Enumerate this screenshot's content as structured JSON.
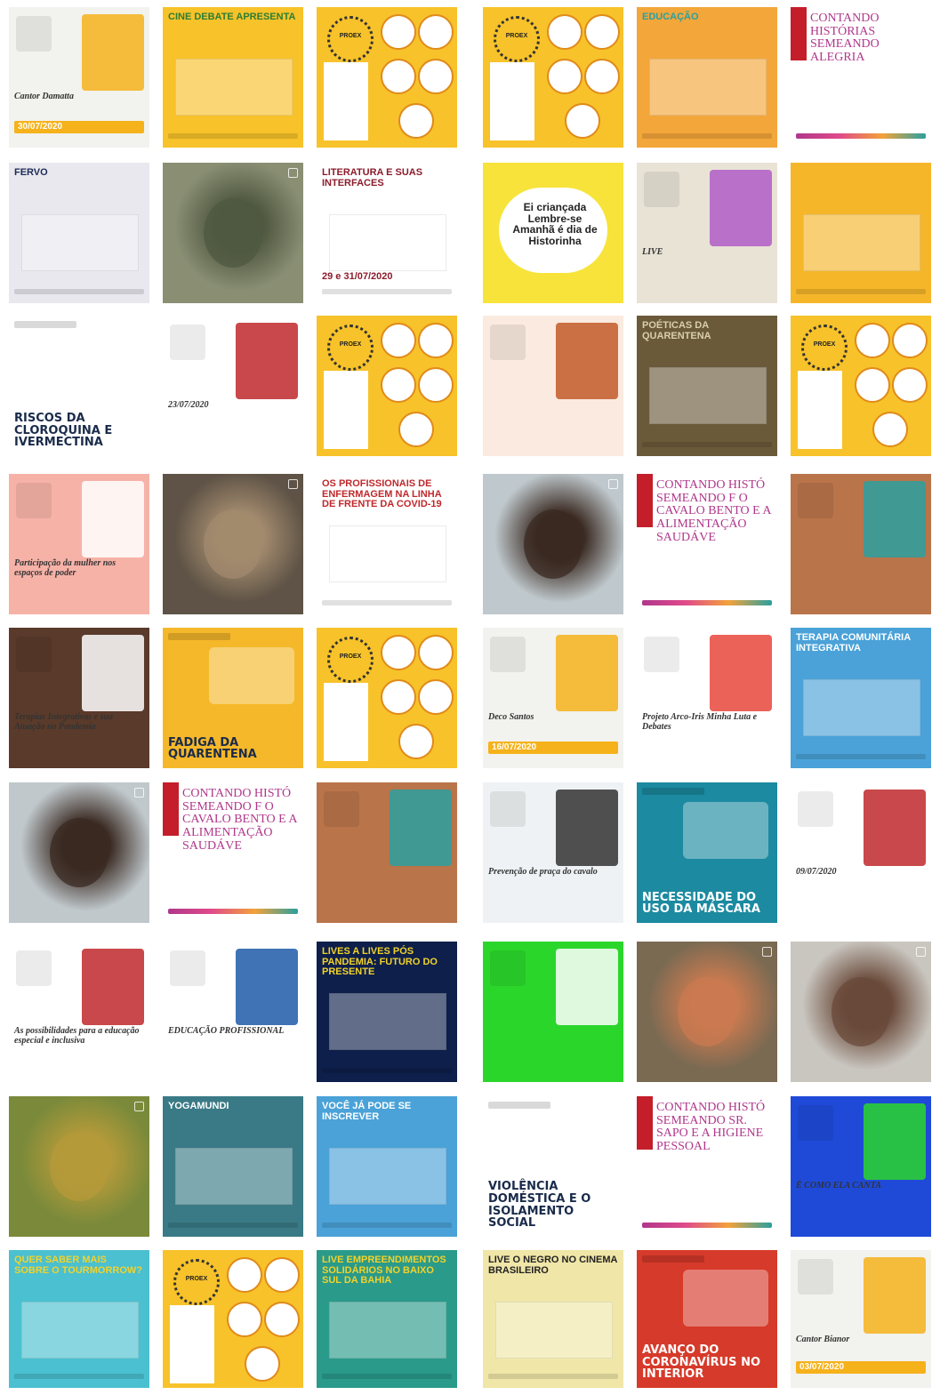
{
  "grid": {
    "tiles": [
      {
        "label": "Cantor Damatta",
        "date": "30/07/2020",
        "bg": "#f2f2ee",
        "accent": "#f6b21b",
        "style": "mixed"
      },
      {
        "label": "CINE DEBATE APRESENTA",
        "bg": "#f7c22a",
        "accent": "#2e7d32",
        "style": "banner"
      },
      {
        "label": "PROEX",
        "bg": "#f7c22a",
        "accent": "#ffffff",
        "style": "ring"
      },
      {
        "label": "PROEX",
        "bg": "#f7c22a",
        "accent": "#ffffff",
        "style": "ring"
      },
      {
        "label": "EDUCAÇÃO",
        "bg": "#f3a63a",
        "accent": "#2aa0a0",
        "style": "banner"
      },
      {
        "label": "CONTANDO HISTÓRIAS SEMEANDO ALEGRIA",
        "bg": "#ffffff",
        "accent": "#b0378b",
        "style": "contando"
      },
      {
        "label": "FERVO",
        "bg": "#e8e8ee",
        "accent": "#1d2a55",
        "style": "banner"
      },
      {
        "label": "",
        "bg": "#8a8f74",
        "accent": "#4f5840",
        "style": "photo"
      },
      {
        "label": "LITERATURA E SUAS INTERFACES",
        "date": "29 e 31/07/2020",
        "bg": "#ffffff",
        "accent": "#8b1c2c",
        "style": "banner"
      },
      {
        "label": "Ei criançada Lembre-se Amanhã é dia de Historinha",
        "bg": "#f7e33a",
        "accent": "#ffffff",
        "style": "cloud"
      },
      {
        "label": "LIVE",
        "bg": "#e9e3d6",
        "accent": "#b05cc7",
        "style": "mixed"
      },
      {
        "label": "",
        "bg": "#f5b62a",
        "accent": "#ffffff",
        "style": "banner"
      },
      {
        "label": "RISCOS DA CLOROQUINA E IVERMECTINA",
        "bg": "#ffffff",
        "accent": "#1a2b4a",
        "style": "boletim"
      },
      {
        "label": "23/07/2020",
        "bg": "#ffffff",
        "accent": "#c0282c",
        "style": "mixed"
      },
      {
        "label": "PROEX",
        "bg": "#f7c22a",
        "accent": "#ffffff",
        "style": "ring"
      },
      {
        "label": "",
        "bg": "#faeadf",
        "accent": "#c25a2a",
        "style": "mixed"
      },
      {
        "label": "POÉTICAS DA QUARENTENA",
        "bg": "#6b5a3a",
        "accent": "#d8cfae",
        "style": "banner"
      },
      {
        "label": "PROEX",
        "bg": "#f7c22a",
        "accent": "#ffffff",
        "style": "ring"
      },
      {
        "label": "Participação da mulher nos espaços de poder",
        "bg": "#f7b2a8",
        "accent": "#ffffff",
        "style": "mixed"
      },
      {
        "label": "",
        "bg": "#5e5346",
        "accent": "#a28a6e",
        "style": "photo"
      },
      {
        "label": "Os profissionais de enfermagem na linha de frente da Covid-19",
        "bg": "#ffffff",
        "accent": "#c0282c",
        "style": "banner"
      },
      {
        "label": "",
        "bg": "#bfc8cc",
        "accent": "#3a2a22",
        "style": "photo"
      },
      {
        "label": "CONTANDO HISTÓ SEMEANDO F O CAVALO BENTO E A ALIMENTAÇÃO SAUDÁVE",
        "bg": "#ffffff",
        "accent": "#b0378b",
        "style": "contando"
      },
      {
        "label": "",
        "bg": "#b9744a",
        "accent": "#2aa0a0",
        "style": "mixed"
      },
      {
        "label": "Terapias Integrativas e sua Atuação no Pandemia",
        "bg": "#5a3a2a",
        "accent": "#ffffff",
        "style": "mixed"
      },
      {
        "label": "FADIGA DA QUARENTENA",
        "bg": "#f5b82a",
        "accent": "#1a2b4a",
        "style": "boletim"
      },
      {
        "label": "PROEX",
        "bg": "#f7c22a",
        "accent": "#ffffff",
        "style": "ring"
      },
      {
        "label": "Deco Santos",
        "date": "16/07/2020",
        "bg": "#f2f2ee",
        "accent": "#f6b21b",
        "style": "mixed"
      },
      {
        "label": "Projeto Arco-Iris Minha Luta e Debates",
        "bg": "#ffffff",
        "accent": "#e8463c",
        "style": "mixed"
      },
      {
        "label": "Terapia Comunitária Integrativa",
        "bg": "#4aa2d8",
        "accent": "#ffffff",
        "style": "banner"
      },
      {
        "label": "",
        "bg": "#c0c8cc",
        "accent": "#3a2a22",
        "style": "photo"
      },
      {
        "label": "CONTANDO HISTÓ SEMEANDO F O CAVALO BENTO E A ALIMENTAÇÃO SAUDÁVE",
        "bg": "#ffffff",
        "accent": "#b0378b",
        "style": "contando"
      },
      {
        "label": "",
        "bg": "#b9744a",
        "accent": "#2aa0a0",
        "style": "mixed"
      },
      {
        "label": "Prevenção de praça do cavalo",
        "bg": "#eef2f4",
        "accent": "#333333",
        "style": "mixed"
      },
      {
        "label": "NECESSIDADE DO USO DA MÁSCARA",
        "bg": "#1c8aa0",
        "accent": "#ffffff",
        "style": "boletim"
      },
      {
        "label": "09/07/2020",
        "bg": "#ffffff",
        "accent": "#c0282c",
        "style": "mixed"
      },
      {
        "label": "As possibilidades para a educação especial e inclusiva",
        "bg": "#ffffff",
        "accent": "#c0282c",
        "style": "mixed"
      },
      {
        "label": "EDUCAÇÃO PROFISSIONAL",
        "bg": "#ffffff",
        "accent": "#1f5aa8",
        "style": "mixed"
      },
      {
        "label": "LIVES A LIVES PÓS PANDEMIA: FUTURO DO PRESENTE",
        "bg": "#0d1f4a",
        "accent": "#f2d22a",
        "style": "banner"
      },
      {
        "label": "",
        "bg": "#2bd62b",
        "accent": "#ffffff",
        "style": "mixed"
      },
      {
        "label": "",
        "bg": "#7a6a52",
        "accent": "#c97a50",
        "style": "photo"
      },
      {
        "label": "",
        "bg": "#c9c6c0",
        "accent": "#6a4a3a",
        "style": "photo"
      },
      {
        "label": "",
        "bg": "#7a8a3a",
        "accent": "#b59a3a",
        "style": "photo"
      },
      {
        "label": "YOGAMUNDI",
        "bg": "#3a7a86",
        "accent": "#ffffff",
        "style": "banner"
      },
      {
        "label": "Você já pode se inscrever",
        "bg": "#4aa2d8",
        "accent": "#ffffff",
        "style": "banner"
      },
      {
        "label": "VIOLÊNCIA DOMÉSTICA E O ISOLAMENTO SOCIAL",
        "bg": "#ffffff",
        "accent": "#1a2b4a",
        "style": "boletim"
      },
      {
        "label": "CONTANDO HISTÓ SEMEANDO SR. SAPO E A HIGIENE PESSOAL",
        "bg": "#ffffff",
        "accent": "#b0378b",
        "style": "contando"
      },
      {
        "label": "É COMO ELA CANTA",
        "bg": "#1f4ad8",
        "accent": "#2bd62b",
        "style": "mixed"
      },
      {
        "label": "QUER SABER MAIS SOBRE O TOURMORROW?",
        "bg": "#4ac0d0",
        "accent": "#f2d22a",
        "style": "banner"
      },
      {
        "label": "PROEX",
        "bg": "#f7c22a",
        "accent": "#ffffff",
        "style": "ring"
      },
      {
        "label": "LIVE EMPREENDIMENTOS SOLIDÁRIOS NO BAIXO SUL DA BAHIA",
        "bg": "#2a9a8a",
        "accent": "#f2d22a",
        "style": "banner"
      },
      {
        "label": "LIVE O NEGRO NO CINEMA BRASILEIRO",
        "bg": "#f0e6a8",
        "accent": "#222222",
        "style": "banner"
      },
      {
        "label": "AVANÇO DO CORONAVÍRUS NO INTERIOR",
        "bg": "#d63a2a",
        "accent": "#ffffff",
        "style": "boletim"
      },
      {
        "label": "Cantor Bianor",
        "date": "03/07/2020",
        "bg": "#f2f2ee",
        "accent": "#f6b21b",
        "style": "mixed"
      }
    ]
  }
}
